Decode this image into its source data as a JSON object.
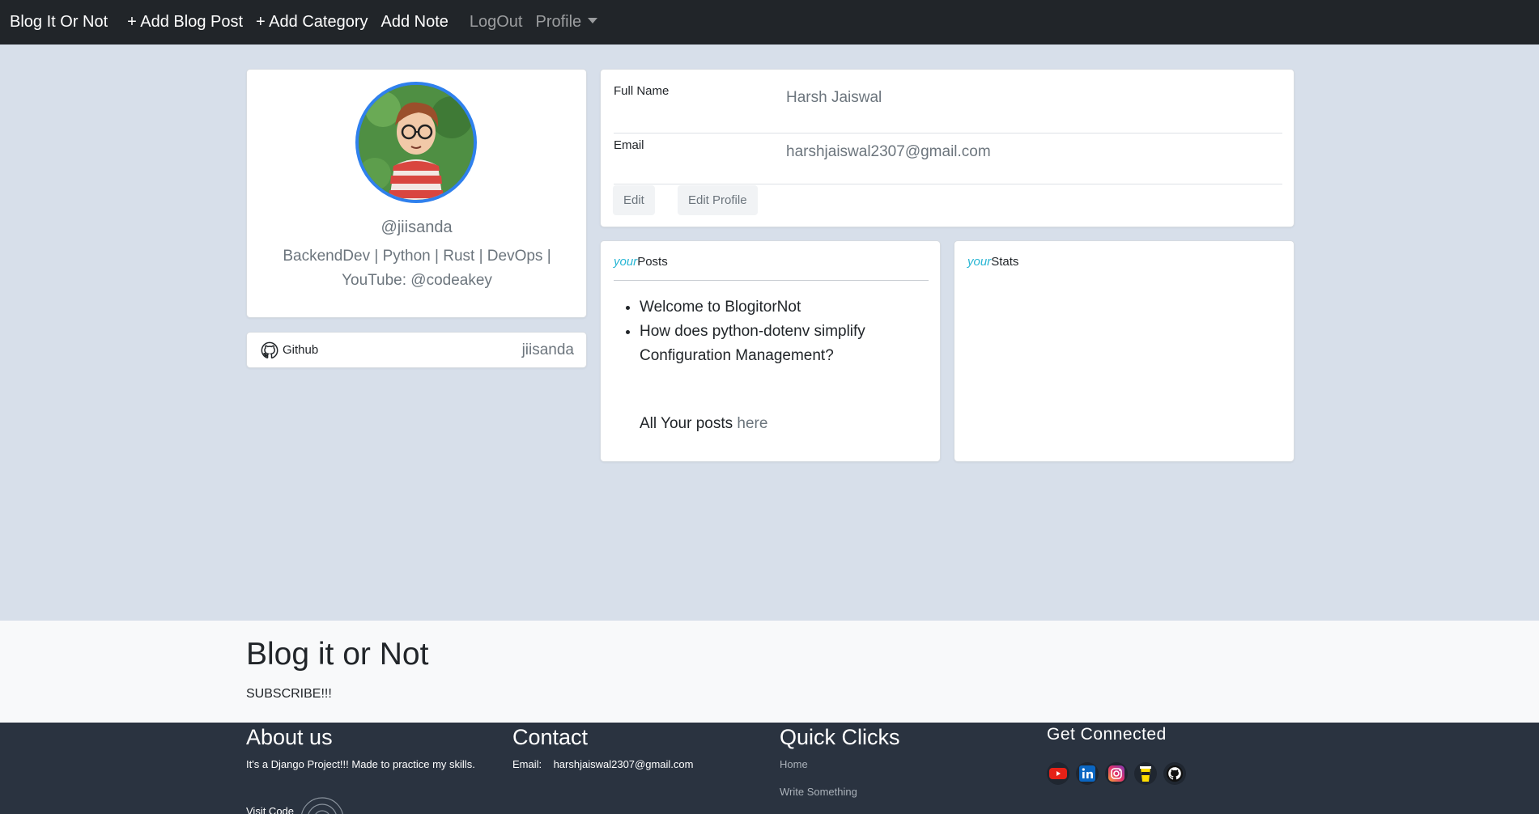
{
  "nav": {
    "brand": "Blog It Or Not",
    "add_blog_post": "+ Add Blog Post",
    "add_category": "+ Add Category",
    "add_note": "Add Note",
    "logout": "LogOut",
    "profile": "Profile"
  },
  "profile": {
    "username": "@jiisanda",
    "bio": "BackendDev | Python | Rust | DevOps | YouTube: @codeakey"
  },
  "github": {
    "label": "Github",
    "value": "jiisanda"
  },
  "info": {
    "full_name_label": "Full Name",
    "full_name_value": "Harsh Jaiswal",
    "email_label": "Email",
    "email_value": "harshjaiswal2307@gmail.com",
    "edit_button": "Edit",
    "edit_profile_button": "Edit Profile"
  },
  "posts": {
    "prefix": "your",
    "title": "Posts",
    "items": [
      "Welcome to BlogitorNot",
      "How does python-dotenv simplify Configuration Management?"
    ],
    "all_posts_text": "All Your posts",
    "all_posts_link": "here"
  },
  "stats": {
    "prefix": "your",
    "title": "Stats"
  },
  "footer": {
    "title": "Blog it or Not",
    "subscribe": "SUBSCRIBE!!!",
    "about_title": "About us",
    "about_text": "It's a Django Project!!! Made to practice my skills.",
    "visit_code": "Visit Code",
    "contact_title": "Contact",
    "contact_email_label": "Email:",
    "contact_email": "harshjaiswal2307@gmail.com",
    "quick_title": "Quick Clicks",
    "quick_links": [
      "Home",
      "Write Something"
    ],
    "connected_title": "Get Connected",
    "social_icons": [
      "youtube-icon",
      "linkedin-icon",
      "instagram-icon",
      "buymeacoffee-icon",
      "github-icon"
    ]
  },
  "colors": {
    "navbar": "#212529",
    "page_bg": "#d7dfea",
    "accent_your": "#29b6d4",
    "footer_dark": "#2a3340",
    "avatar_border": "#2f80ed"
  }
}
